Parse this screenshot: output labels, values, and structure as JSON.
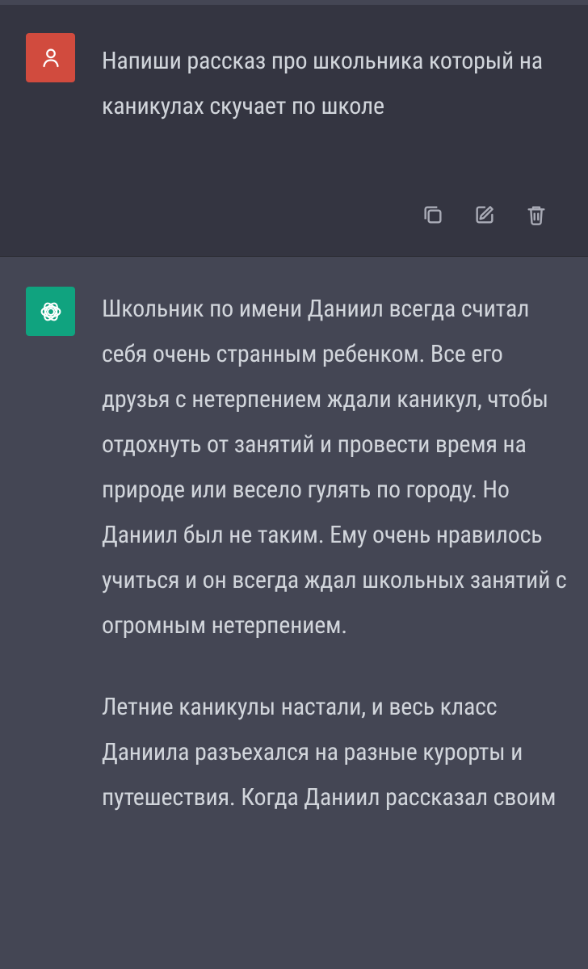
{
  "conversation": {
    "user_message": {
      "avatar_icon": "user-icon",
      "text": "Напиши рассказ про школьника который на каникулах скучает по школе",
      "actions": [
        {
          "name": "copy-icon"
        },
        {
          "name": "edit-icon"
        },
        {
          "name": "trash-icon"
        }
      ]
    },
    "assistant_message": {
      "avatar_icon": "chatgpt-logo-icon",
      "paragraphs": [
        "Школьник по имени Даниил всегда считал себя очень странным ребенком. Все его друзья с нетерпением ждали каникул, чтобы отдохнуть от занятий и провести время на природе или весело гулять по городу. Но Даниил был не таким. Ему очень нравилось учиться и он всегда ждал школьных занятий с огромным нетерпением.",
        "Летние каникулы настали, и весь класс Даниила разъехался на разные курорты и путешествия. Когда Даниил рассказал своим"
      ]
    }
  },
  "colors": {
    "user_background": "#343541",
    "assistant_background": "#444654",
    "user_avatar": "#d14b3e",
    "assistant_avatar": "#10a37f",
    "text": "#d1d5db",
    "icon": "#a9abb6"
  }
}
